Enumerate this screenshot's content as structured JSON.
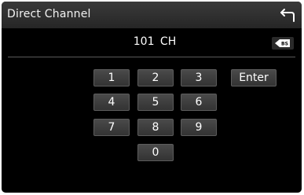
{
  "header": {
    "title": "Direct Channel",
    "back_icon": "back-arrow-icon"
  },
  "display": {
    "channel": "101  CH",
    "backspace_icon": "backspace-icon",
    "backspace_label": "BS"
  },
  "keypad": {
    "keys": [
      "1",
      "2",
      "3",
      "4",
      "5",
      "6",
      "7",
      "8",
      "9",
      "0"
    ],
    "enter_label": "Enter"
  },
  "colors": {
    "background": "#000000",
    "header": "#2e2e2e",
    "key": "#3c3c3c",
    "text": "#ffffff"
  }
}
